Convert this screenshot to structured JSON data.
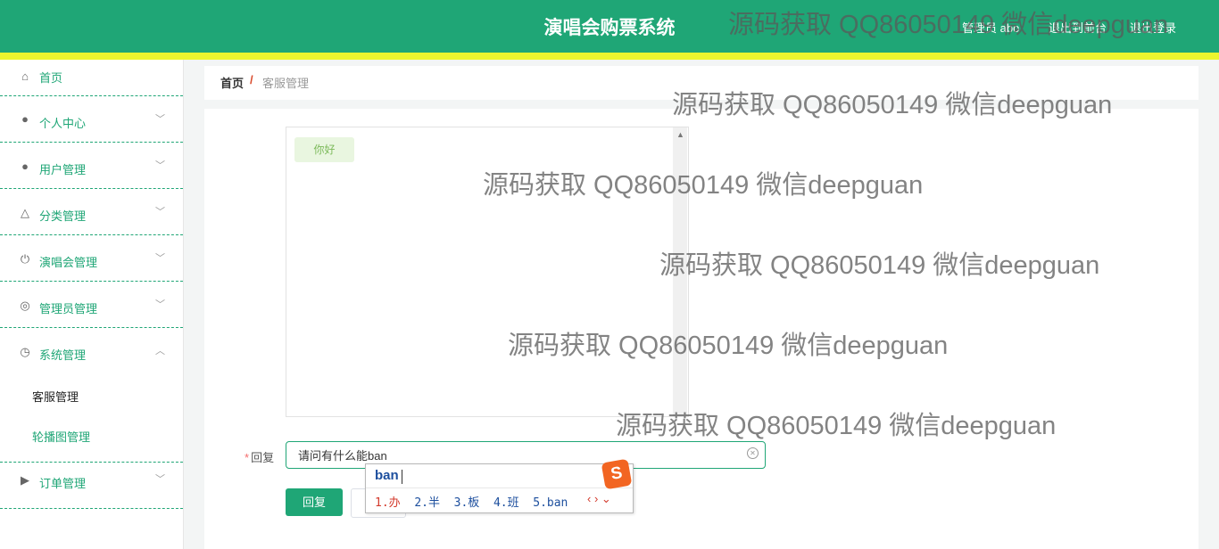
{
  "header": {
    "title": "演唱会购票系统",
    "admin_text": "管理员 abo",
    "back_link": "退出到前台",
    "logout_link": "退出登录"
  },
  "sidebar": {
    "items": [
      {
        "label": "首页",
        "icon": "home-icon"
      },
      {
        "label": "个人中心",
        "icon": "user-icon"
      },
      {
        "label": "用户管理",
        "icon": "bulb-icon"
      },
      {
        "label": "分类管理",
        "icon": "bell-off-icon"
      },
      {
        "label": "演唱会管理",
        "icon": "power-icon"
      },
      {
        "label": "管理员管理",
        "icon": "gauge-icon"
      },
      {
        "label": "系统管理",
        "icon": "clock-icon"
      },
      {
        "label": "订单管理",
        "icon": "ticket-icon"
      }
    ],
    "sub_items": [
      "客服管理",
      "轮播图管理"
    ]
  },
  "breadcrumb": {
    "home": "首页",
    "separator": "/",
    "current": "客服管理"
  },
  "chat": {
    "messages": [
      "你好"
    ]
  },
  "form": {
    "reply_label": "回复",
    "required_mark": "*",
    "reply_value": "请问有什么能ban",
    "submit_label": "回复"
  },
  "ime": {
    "composition": "ban",
    "candidates": [
      "1.办",
      "2.半",
      "3.板",
      "4.班",
      "5.ban"
    ],
    "logo": "S"
  },
  "watermark": "源码获取 QQ86050149 微信deepguan",
  "colors": {
    "primary": "#1fa676",
    "accent_bar": "#ecf52e",
    "ime_orange": "#f26522"
  }
}
